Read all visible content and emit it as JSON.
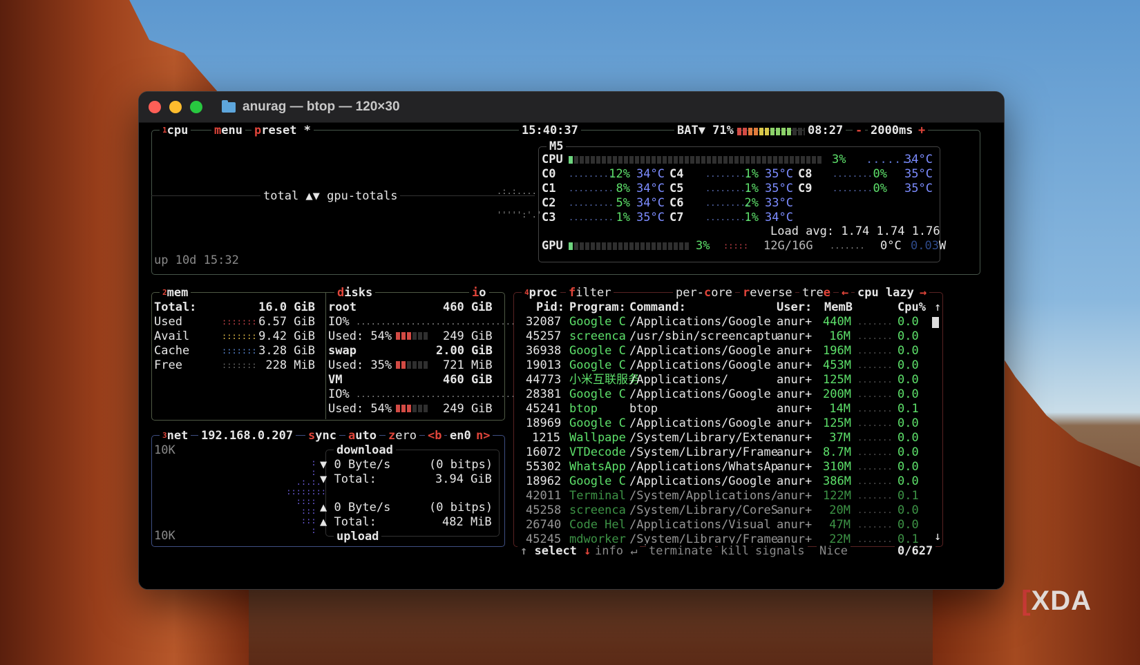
{
  "window": {
    "title": "anurag — btop — 120×30"
  },
  "cpu": {
    "label": "cpu",
    "menu": "menu",
    "preset": "preset *",
    "time": "15:40:37",
    "battery": "BAT▼ 71%",
    "battery_time": "08:27",
    "minus": "-",
    "interval": "2000ms",
    "plus": "+",
    "graph_label": "total ▲▼ gpu-totals",
    "uptime": "up 10d 15:32",
    "model": "M5",
    "total_label": "CPU",
    "total_pct": "3%",
    "total_temp": "34°C",
    "cores_left": [
      {
        "name": "C0",
        "pct": "12%",
        "temp": "34°C"
      },
      {
        "name": "C1",
        "pct": "8%",
        "temp": "34°C"
      },
      {
        "name": "C2",
        "pct": "5%",
        "temp": "34°C"
      },
      {
        "name": "C3",
        "pct": "1%",
        "temp": "35°C"
      }
    ],
    "cores_mid": [
      {
        "name": "C4",
        "pct": "1%",
        "temp": "35°C"
      },
      {
        "name": "C5",
        "pct": "1%",
        "temp": "35°C"
      },
      {
        "name": "C6",
        "pct": "2%",
        "temp": "33°C"
      },
      {
        "name": "C7",
        "pct": "1%",
        "temp": "34°C"
      }
    ],
    "cores_right": [
      {
        "name": "C8",
        "pct": "0%",
        "temp": "35°C"
      },
      {
        "name": "C9",
        "pct": "0%",
        "temp": "35°C"
      }
    ],
    "load_avg": "Load avg: 1.74 1.74 1.76",
    "gpu_label": "GPU",
    "gpu_pct": "3%",
    "gpu_mem": "12G/16G",
    "gpu_temp": "0°C",
    "gpu_watt": "0.03",
    "gpu_watt_unit": "W"
  },
  "mem": {
    "label": "mem",
    "rows": [
      {
        "name": "Total:",
        "value": "16.0 GiB"
      },
      {
        "name": "Used",
        "value": "6.57 GiB"
      },
      {
        "name": "Avail",
        "value": "9.42 GiB"
      },
      {
        "name": "Cache",
        "value": "3.28 GiB"
      },
      {
        "name": "Free",
        "value": "228 MiB"
      }
    ]
  },
  "disks": {
    "label": "disks",
    "io": "io",
    "root": {
      "name": "root",
      "size": "460 GiB",
      "io": "IO%",
      "used": "Used: 54%",
      "used_val": "249 GiB"
    },
    "swap": {
      "name": "swap",
      "size": "2.00 GiB",
      "used": "Used: 35%",
      "used_val": "721 MiB"
    },
    "vm": {
      "name": "VM",
      "size": "460 GiB",
      "io": "IO%",
      "used": "Used: 54%",
      "used_val": "249 GiB"
    }
  },
  "net": {
    "label": "net",
    "ip": "192.168.0.207",
    "sync": "sync",
    "auto": "auto",
    "zero": "zero",
    "prev": "<b",
    "iface": "en0",
    "next": "n>",
    "scale_top": "10K",
    "scale_bottom": "10K",
    "download": "download",
    "upload": "upload",
    "dl_rate": "▼ 0 Byte/s",
    "dl_bits": "(0 bitps)",
    "dl_total_label": "▼ Total:",
    "dl_total": "3.94 GiB",
    "ul_rate": "▲ 0 Byte/s",
    "ul_bits": "(0 bitps)",
    "ul_total_label": "▲ Total:",
    "ul_total": "482 MiB"
  },
  "proc": {
    "label": "proc",
    "filter": "filter",
    "per_core": "per-core",
    "reverse": "reverse",
    "tree": "tree",
    "sort_prev": "←",
    "sort": "cpu lazy",
    "sort_next": "→",
    "headers": {
      "pid": "Pid:",
      "program": "Program:",
      "command": "Command:",
      "user": "User:",
      "mem": "MemB",
      "cpu": "Cpu%"
    },
    "rows": [
      {
        "pid": "32087",
        "program": "Google C",
        "command": "/Applications/Google",
        "user": "anur+",
        "mem": "440M",
        "cpu": "0.0"
      },
      {
        "pid": "45257",
        "program": "screenca",
        "command": "/usr/sbin/screencaptu",
        "user": "anur+",
        "mem": "16M",
        "cpu": "0.0"
      },
      {
        "pid": "36938",
        "program": "Google C",
        "command": "/Applications/Google",
        "user": "anur+",
        "mem": "196M",
        "cpu": "0.0"
      },
      {
        "pid": "19013",
        "program": "Google C",
        "command": "/Applications/Google",
        "user": "anur+",
        "mem": "453M",
        "cpu": "0.0"
      },
      {
        "pid": "44773",
        "program": "小米互联服务",
        "command": "/Applications/",
        "user": "anur+",
        "mem": "125M",
        "cpu": "0.0"
      },
      {
        "pid": "28381",
        "program": "Google C",
        "command": "/Applications/Google",
        "user": "anur+",
        "mem": "200M",
        "cpu": "0.0"
      },
      {
        "pid": "45241",
        "program": "btop",
        "command": "btop",
        "user": "anur+",
        "mem": "14M",
        "cpu": "0.1"
      },
      {
        "pid": "18969",
        "program": "Google C",
        "command": "/Applications/Google",
        "user": "anur+",
        "mem": "125M",
        "cpu": "0.0"
      },
      {
        "pid": "1215",
        "program": "Wallpape",
        "command": "/System/Library/Exten",
        "user": "anur+",
        "mem": "37M",
        "cpu": "0.0"
      },
      {
        "pid": "16072",
        "program": "VTDecode",
        "command": "/System/Library/Frame",
        "user": "anur+",
        "mem": "8.7M",
        "cpu": "0.0"
      },
      {
        "pid": "55302",
        "program": "WhatsApp",
        "command": "/Applications/WhatsAp",
        "user": "anur+",
        "mem": "310M",
        "cpu": "0.0"
      },
      {
        "pid": "18962",
        "program": "Google C",
        "command": "/Applications/Google",
        "user": "anur+",
        "mem": "386M",
        "cpu": "0.0"
      },
      {
        "pid": "42011",
        "program": "Terminal",
        "command": "/System/Applications/",
        "user": "anur+",
        "mem": "122M",
        "cpu": "0.1"
      },
      {
        "pid": "45258",
        "program": "screenca",
        "command": "/System/Library/CoreS",
        "user": "anur+",
        "mem": "20M",
        "cpu": "0.0"
      },
      {
        "pid": "26740",
        "program": "Code Hel",
        "command": "/Applications/Visual",
        "user": "anur+",
        "mem": "47M",
        "cpu": "0.0"
      },
      {
        "pid": "45245",
        "program": "mdworker",
        "command": "/System/Library/Frame",
        "user": "anur+",
        "mem": "22M",
        "cpu": "0.1"
      }
    ],
    "footer": {
      "select": "select",
      "info": "info",
      "terminate": "terminate",
      "kill": "kill",
      "signals": "signals",
      "nice": "Nice",
      "count": "0/627"
    }
  },
  "watermark": "XDA"
}
